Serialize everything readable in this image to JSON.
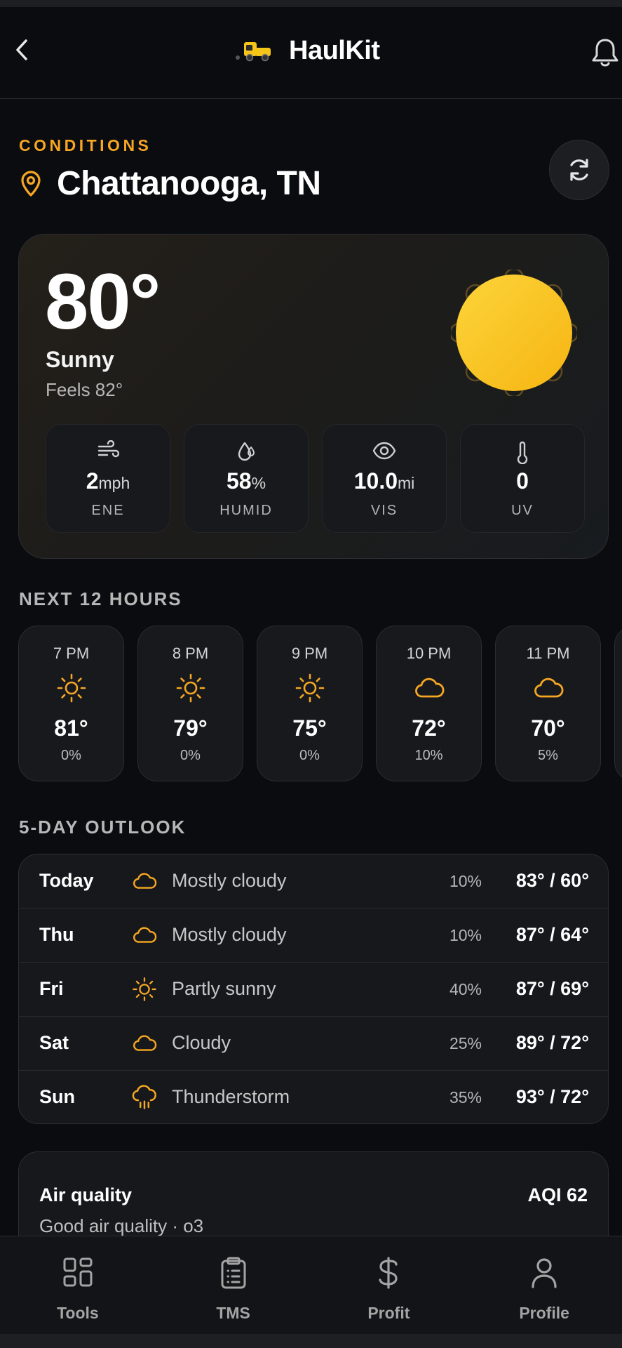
{
  "app": {
    "name": "HaulKit"
  },
  "colors": {
    "accent": "#f5a623",
    "sun": "#fbc219",
    "background": "#0b0c0f",
    "card": "#16181c"
  },
  "icons": {
    "back": "chevron-left-icon",
    "logo": "truck-icon",
    "notifications": "bell-icon",
    "location": "map-pin-icon",
    "refresh": "refresh-icon"
  },
  "location": {
    "eyebrow": "CONDITIONS",
    "name": "Chattanooga, TN"
  },
  "current": {
    "temp": "80°",
    "condition": "Sunny",
    "feels": "Feels 82°",
    "icon": "sun-icon",
    "stats": [
      {
        "icon": "wind-icon",
        "value": "2",
        "unit": "mph",
        "label": "ENE"
      },
      {
        "icon": "droplet-icon",
        "value": "58",
        "unit": "%",
        "label": "HUMID"
      },
      {
        "icon": "eye-icon",
        "value": "10.0",
        "unit": "mi",
        "label": "VIS"
      },
      {
        "icon": "thermometer-icon",
        "value": "0",
        "unit": "",
        "label": "UV"
      }
    ]
  },
  "hourly": {
    "title": "NEXT 12 HOURS",
    "items": [
      {
        "time": "7 PM",
        "icon": "sun-icon",
        "temp": "81°",
        "precip": "0%"
      },
      {
        "time": "8 PM",
        "icon": "sun-icon",
        "temp": "79°",
        "precip": "0%"
      },
      {
        "time": "9 PM",
        "icon": "sun-icon",
        "temp": "75°",
        "precip": "0%"
      },
      {
        "time": "10 PM",
        "icon": "cloud-icon",
        "temp": "72°",
        "precip": "10%"
      },
      {
        "time": "11 PM",
        "icon": "cloud-icon",
        "temp": "70°",
        "precip": "5%"
      },
      {
        "time": "",
        "icon": "cloud-icon",
        "temp": "",
        "precip": ""
      }
    ]
  },
  "outlook": {
    "title": "5-DAY OUTLOOK",
    "days": [
      {
        "day": "Today",
        "icon": "cloud-icon",
        "condition": "Mostly cloudy",
        "precip": "10%",
        "range": "83° / 60°"
      },
      {
        "day": "Thu",
        "icon": "cloud-icon",
        "condition": "Mostly cloudy",
        "precip": "10%",
        "range": "87° / 64°"
      },
      {
        "day": "Fri",
        "icon": "sun-icon",
        "condition": "Partly sunny",
        "precip": "40%",
        "range": "87° / 69°"
      },
      {
        "day": "Sat",
        "icon": "cloud-icon",
        "condition": "Cloudy",
        "precip": "25%",
        "range": "89° / 72°"
      },
      {
        "day": "Sun",
        "icon": "thunderstorm-icon",
        "condition": "Thunderstorm",
        "precip": "35%",
        "range": "93° / 72°"
      }
    ]
  },
  "air": {
    "title": "Air quality",
    "aqi": "AQI 62",
    "summary": "Good air quality · o3"
  },
  "nav": [
    {
      "label": "Tools",
      "icon": "grid-icon"
    },
    {
      "label": "TMS",
      "icon": "clipboard-icon"
    },
    {
      "label": "Profit",
      "icon": "dollar-icon"
    },
    {
      "label": "Profile",
      "icon": "user-icon"
    }
  ]
}
